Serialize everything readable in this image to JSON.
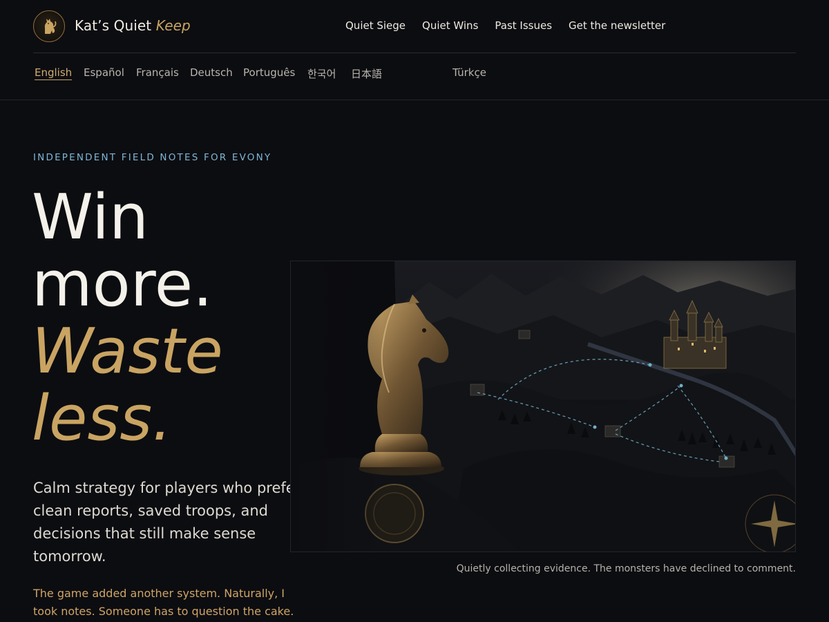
{
  "brand": {
    "name": "Kat’s Quiet",
    "accent": "Keep",
    "logo_icon": "cat-knight-emblem"
  },
  "nav": {
    "items": [
      "Quiet Siege",
      "Quiet Wins",
      "Past Issues",
      "Get the newsletter"
    ]
  },
  "languages": {
    "active": "English",
    "items": [
      "English",
      "Español",
      "Français",
      "Deutsch",
      "Português",
      "한국어",
      "日本語",
      "Türkçe"
    ]
  },
  "hero": {
    "kicker": "INDEPENDENT FIELD NOTES FOR EVONY",
    "headline": [
      "Win",
      "more.",
      "Waste",
      "less."
    ],
    "lede": "Calm strategy for players who prefer clean reports, saved troops, and decisions that still make sense tomorrow.",
    "aside": "The game added another system. Naturally, I took notes. Someone has to question the cake.",
    "caption": "Quietly collecting evidence. The monsters have declined to comment.",
    "image_icon": "chess-knight-over-fantasy-map"
  },
  "colors": {
    "background": "#0c0d11",
    "accent_gold": "#c9a462",
    "kicker_blue": "#7fb6d6",
    "text": "#f4f1ea"
  }
}
